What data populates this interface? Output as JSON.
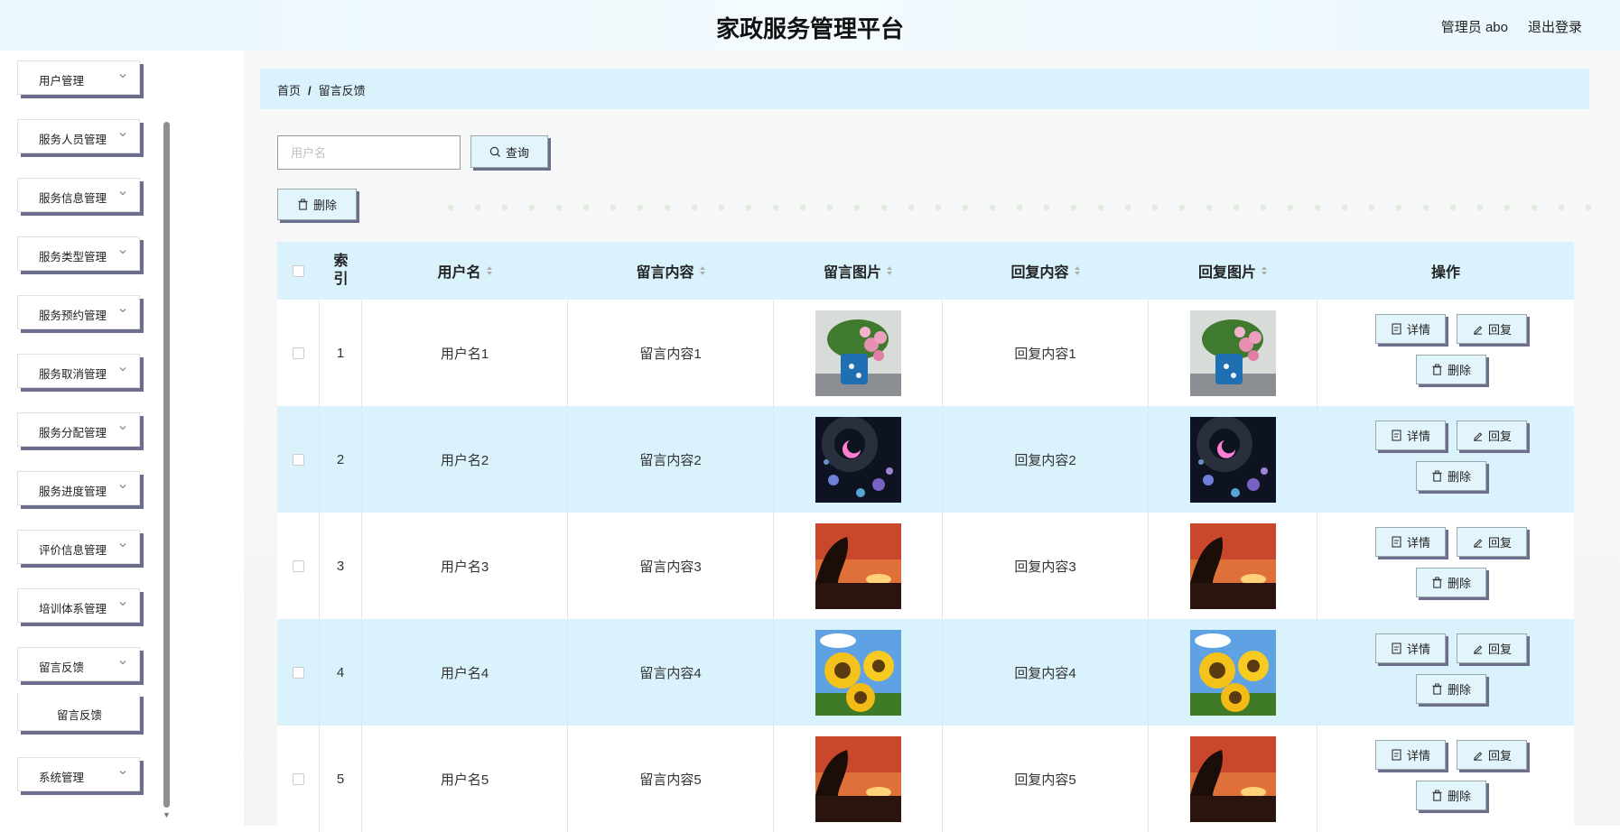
{
  "header": {
    "title": "家政服务管理平台",
    "user": "管理员 abo",
    "logout": "退出登录"
  },
  "sidebar": {
    "items": [
      {
        "label": "用户管理"
      },
      {
        "label": "服务人员管理"
      },
      {
        "label": "服务信息管理"
      },
      {
        "label": "服务类型管理"
      },
      {
        "label": "服务预约管理"
      },
      {
        "label": "服务取消管理"
      },
      {
        "label": "服务分配管理"
      },
      {
        "label": "服务进度管理"
      },
      {
        "label": "评价信息管理"
      },
      {
        "label": "培训体系管理"
      },
      {
        "label": "留言反馈"
      }
    ],
    "sub_item": "留言反馈",
    "last_item": "系统管理"
  },
  "breadcrumb": {
    "home": "首页",
    "sep": "/",
    "current": "留言反馈"
  },
  "search": {
    "placeholder": "用户名",
    "button": "查询"
  },
  "toolbar": {
    "delete": "删除"
  },
  "table": {
    "headers": {
      "index": "索引",
      "username": "用户名",
      "message": "留言内容",
      "message_image": "留言图片",
      "reply": "回复内容",
      "reply_image": "回复图片",
      "actions": "操作"
    },
    "actions": {
      "detail": "详情",
      "reply": "回复",
      "delete": "删除"
    },
    "rows": [
      {
        "index": "1",
        "username": "用户名1",
        "message": "留言内容1",
        "reply": "回复内容1",
        "image": "flowers"
      },
      {
        "index": "2",
        "username": "用户名2",
        "message": "留言内容2",
        "reply": "回复内容2",
        "image": "night-sky"
      },
      {
        "index": "3",
        "username": "用户名3",
        "message": "留言内容3",
        "reply": "回复内容3",
        "image": "sunset"
      },
      {
        "index": "4",
        "username": "用户名4",
        "message": "留言内容4",
        "reply": "回复内容4",
        "image": "sunflowers"
      },
      {
        "index": "5",
        "username": "用户名5",
        "message": "留言内容5",
        "reply": "回复内容5",
        "image": "sunset"
      }
    ]
  }
}
